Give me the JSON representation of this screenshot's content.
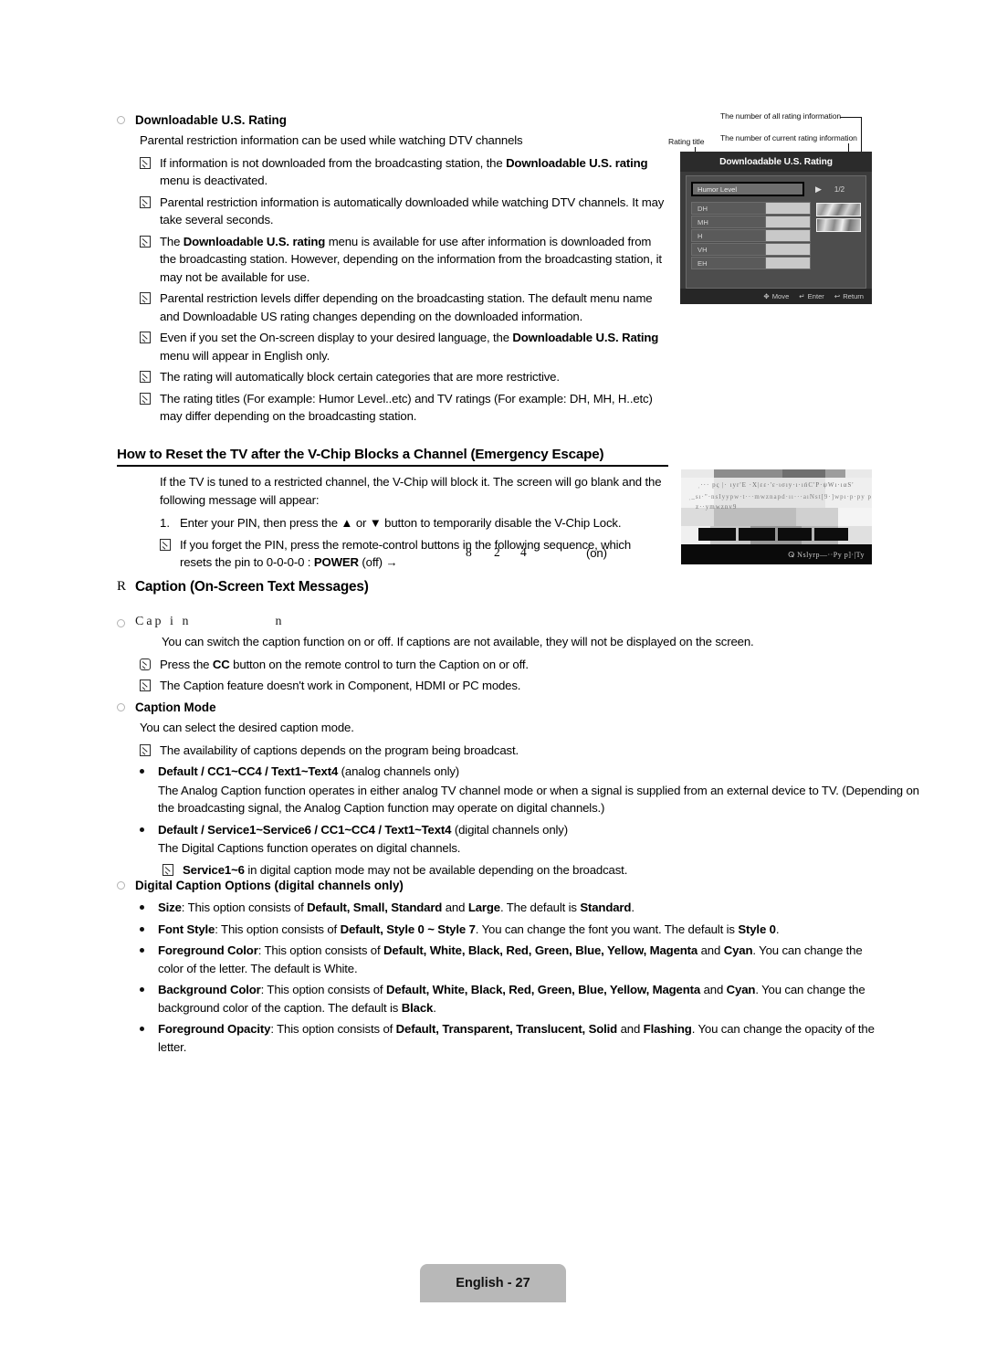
{
  "page": {
    "footer_label": "English - 27"
  },
  "section_downloadable": {
    "heading": "Downloadable U.S. Rating",
    "intro": "Parental restriction information can be used while watching DTV channels",
    "notes": [
      {
        "parts": [
          {
            "t": "If information is not downloaded from the broadcasting station, the ",
            "b": false
          },
          {
            "t": "Downloadable U.S. rating",
            "b": true
          },
          {
            "t": " menu is deactivated.",
            "b": false
          }
        ]
      },
      {
        "parts": [
          {
            "t": "Parental restriction information is automatically downloaded while watching DTV channels. It may take several seconds.",
            "b": false
          }
        ]
      },
      {
        "parts": [
          {
            "t": "The ",
            "b": false
          },
          {
            "t": "Downloadable U.S. rating",
            "b": true
          },
          {
            "t": " menu is available for use after information is downloaded from the broadcasting station. However, depending on the information from the broadcasting station, it may not be available for use.",
            "b": false
          }
        ]
      },
      {
        "parts": [
          {
            "t": "Parental restriction levels differ depending on the broadcasting station. The default menu name and Downloadable US rating changes depending on the downloaded information.",
            "b": false
          }
        ]
      },
      {
        "parts": [
          {
            "t": "Even if you set the On-screen display to your desired language, the ",
            "b": false
          },
          {
            "t": "Downloadable U.S. Rating",
            "b": true
          },
          {
            "t": " menu will appear in English only.",
            "b": false
          }
        ]
      },
      {
        "parts": [
          {
            "t": "The rating will automatically block certain categories that are more restrictive.",
            "b": false
          }
        ]
      },
      {
        "parts": [
          {
            "t": "The rating titles (For example: Humor Level..etc) and TV ratings (For example: DH, MH, H..etc) may differ depending on the broadcasting station.",
            "b": false
          }
        ]
      }
    ]
  },
  "osd": {
    "title": "Downloadable U.S. Rating",
    "rating_title_value": "Humor Level",
    "arrow_glyph": "▶",
    "page_count": "1/2",
    "items": [
      "DH",
      "MH",
      "H",
      "VH",
      "EH"
    ],
    "footer": [
      {
        "icon": "✥",
        "label": "Move"
      },
      {
        "icon": "↵",
        "label": "Enter"
      },
      {
        "icon": "↩",
        "label": "Return"
      }
    ],
    "callouts": {
      "rating_title": "Rating title",
      "all_rating": "The number of all rating information",
      "current_rating": "The number of current rating information"
    }
  },
  "section_vchip": {
    "heading": "How to Reset the TV after the V-Chip Blocks a Channel (Emergency Escape)",
    "intro": "If the TV is tuned to a restricted channel, the V-Chip will block it. The screen will go blank and the following message will appear:",
    "step_number": "1.",
    "step_text": "Enter your PIN, then press the ▲ or ▼ button to temporarily disable the V-Chip Lock.",
    "note_parts": [
      {
        "t": "If you forget the PIN, press the remote-control buttons in the following sequence, which resets the pin to 0-0-0-0 : ",
        "b": false
      },
      {
        "t": "POWER",
        "b": true
      },
      {
        "t": " (off) →",
        "b": false
      }
    ],
    "sequence_digits": [
      "8",
      "2",
      "4"
    ],
    "sequence_end": "(on)"
  },
  "tv_screen": {
    "line1": "ˌ··· pς |· ıyr'E ·X|εε·'ε·ισıy·ı·ıńC'P·ψWı·ıαS'",
    "line2": "ˌ_sı·\"·nsIyypw·t···mwznapd·ıı···aıNst[9·]wpı·p·py p]· sς",
    "line3": "z··ymwznv9",
    "bottom": "ⵕ Nslyrp—··Py p]·|Ty"
  },
  "section_caption": {
    "r_glyph": "R",
    "heading": "Caption (On-Screen Text Messages)",
    "degraded_heading_a": "Cap  i  n",
    "degraded_heading_b": "n",
    "caption_desc": "You can switch the caption function on or off. If captions are not available, they will not be displayed on the screen.",
    "notes": [
      {
        "icon": "remote",
        "parts": [
          {
            "t": "Press the ",
            "b": false
          },
          {
            "t": "CC",
            "b": true
          },
          {
            "t": " button on the remote control to turn the Caption on or off.",
            "b": false
          }
        ]
      },
      {
        "icon": "note",
        "parts": [
          {
            "t": "The Caption feature doesn't work in Component, HDMI or PC modes.",
            "b": false
          }
        ]
      }
    ]
  },
  "section_caption_mode": {
    "heading": "Caption Mode",
    "desc": "You can select the desired caption mode.",
    "note": "The availability of captions depends on the program being broadcast.",
    "bullets": [
      {
        "title_parts": [
          {
            "t": "Default / CC1~CC4 / Text1~Text4",
            "b": true
          },
          {
            "t": " (analog channels only)",
            "b": false
          }
        ],
        "body": "The Analog Caption function operates in either analog TV channel mode or when a signal is supplied from an external device to TV. (Depending on the broadcasting signal, the Analog Caption function may operate on digital channels.)"
      },
      {
        "title_parts": [
          {
            "t": "Default / Service1~Service6 / CC1~CC4 / Text1~Text4",
            "b": true
          },
          {
            "t": " (digital channels only)",
            "b": false
          }
        ],
        "body": "The Digital Captions function operates on digital channels."
      }
    ],
    "sub_note_parts": [
      {
        "t": "Service1~6",
        "b": true
      },
      {
        "t": " in digital caption mode may not be available depending on the broadcast.",
        "b": false
      }
    ]
  },
  "section_digital_options": {
    "heading": "Digital Caption Options (digital channels only)",
    "bullets": [
      [
        {
          "t": "Size",
          "b": true
        },
        {
          "t": ": This option consists of ",
          "b": false
        },
        {
          "t": "Default, Small, Standard",
          "b": true
        },
        {
          "t": " and ",
          "b": false
        },
        {
          "t": "Large",
          "b": true
        },
        {
          "t": ". The default is ",
          "b": false
        },
        {
          "t": "Standard",
          "b": true
        },
        {
          "t": ".",
          "b": false
        }
      ],
      [
        {
          "t": "Font Style",
          "b": true
        },
        {
          "t": ": This option consists of ",
          "b": false
        },
        {
          "t": "Default, Style 0 ~ Style 7",
          "b": true
        },
        {
          "t": ". You can change the font you want. The default is ",
          "b": false
        },
        {
          "t": "Style 0",
          "b": true
        },
        {
          "t": ".",
          "b": false
        }
      ],
      [
        {
          "t": "Foreground Color",
          "b": true
        },
        {
          "t": ": This option consists of ",
          "b": false
        },
        {
          "t": "Default, White, Black, Red, Green, Blue, Yellow, Magenta",
          "b": true
        },
        {
          "t": " and ",
          "b": false
        },
        {
          "t": "Cyan",
          "b": true
        },
        {
          "t": ". You can change the color of the letter. The default is White.",
          "b": false
        }
      ],
      [
        {
          "t": "Background Color",
          "b": true
        },
        {
          "t": ": This option consists of ",
          "b": false
        },
        {
          "t": "Default, White, Black, Red, Green, Blue, Yellow, Magenta",
          "b": true
        },
        {
          "t": " and ",
          "b": false
        },
        {
          "t": "Cyan",
          "b": true
        },
        {
          "t": ". You can change the background color of the caption. The default is ",
          "b": false
        },
        {
          "t": "Black",
          "b": true
        },
        {
          "t": ".",
          "b": false
        }
      ],
      [
        {
          "t": "Foreground Opacity",
          "b": true
        },
        {
          "t": ": This option consists of ",
          "b": false
        },
        {
          "t": "Default, Transparent, Translucent, Solid",
          "b": true
        },
        {
          "t": " and ",
          "b": false
        },
        {
          "t": "Flashing",
          "b": true
        },
        {
          "t": ". You can change the opacity of the letter.",
          "b": false
        }
      ]
    ]
  }
}
